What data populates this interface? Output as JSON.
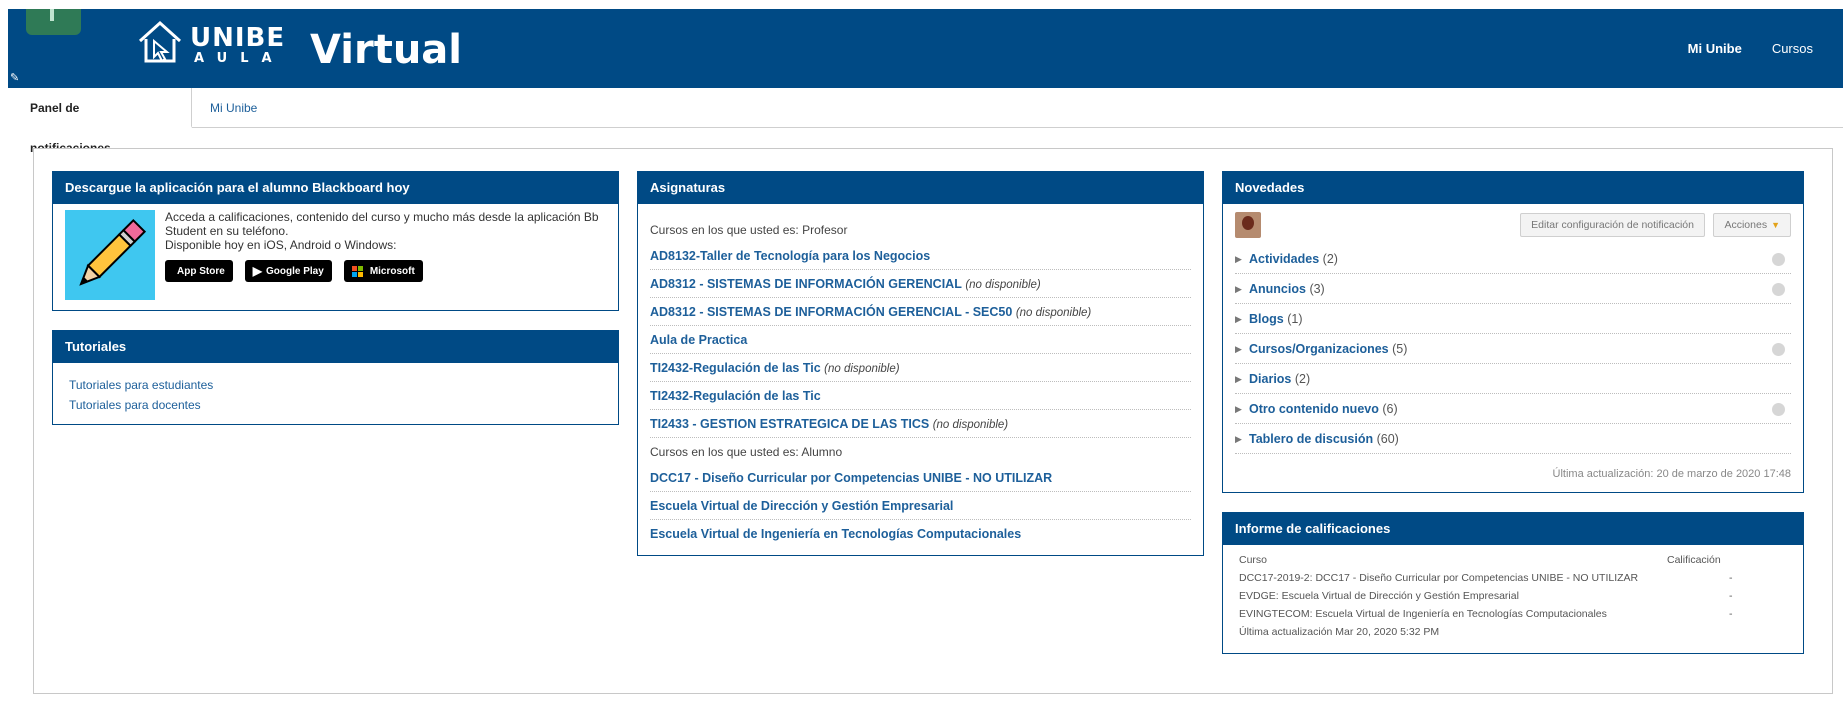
{
  "header": {
    "logo_unibe": "UNIBE",
    "logo_aula": "AULA",
    "logo_virtual": "Virtual",
    "nav": [
      {
        "label": "Mi Unibe"
      },
      {
        "label": "Cursos"
      }
    ],
    "colors": {
      "primary": "#004a85",
      "accent_green": "#2f7a56"
    }
  },
  "tabs": [
    {
      "label": "Panel de notificaciones"
    },
    {
      "label": "Mi Unibe"
    }
  ],
  "download": {
    "title": "Descargue la aplicación para el alumno Blackboard hoy",
    "line1": "Acceda a calificaciones, contenido del curso y mucho más desde la aplicación Bb Student en su teléfono.",
    "line2": "Disponible hoy en iOS, Android o Windows:",
    "stores": [
      "App Store",
      "Google Play",
      "Microsoft"
    ]
  },
  "tutorials": {
    "title": "Tutoriales",
    "links": [
      "Tutoriales para estudiantes",
      "Tutoriales para docentes"
    ]
  },
  "courses": {
    "title": "Asignaturas",
    "teacher_caption": "Cursos en los que usted es: Profesor",
    "teacher_courses": [
      {
        "name": "AD8132-Taller de Tecnología para los Negocios",
        "note": ""
      },
      {
        "name": "AD8312 - SISTEMAS DE INFORMACIÓN GERENCIAL",
        "note": "(no disponible)"
      },
      {
        "name": "AD8312 - SISTEMAS DE INFORMACIÓN GERENCIAL - SEC50",
        "note": "(no disponible)"
      },
      {
        "name": "Aula de Practica",
        "note": ""
      },
      {
        "name": "TI2432-Regulación de las Tic",
        "note": "(no disponible)"
      },
      {
        "name": "TI2432-Regulación de las Tic",
        "note": ""
      },
      {
        "name": "TI2433 - GESTION ESTRATEGICA DE LAS TICS",
        "note": "(no disponible)"
      }
    ],
    "student_caption": "Cursos en los que usted es: Alumno",
    "student_courses": [
      {
        "name": "DCC17 - Diseño Curricular por Competencias UNIBE - NO UTILIZAR"
      },
      {
        "name": "Escuela Virtual de Dirección y Gestión Empresarial"
      },
      {
        "name": "Escuela Virtual de Ingeniería en Tecnologías Computacionales"
      }
    ]
  },
  "news": {
    "title": "Novedades",
    "config_button": "Editar configuración de notificación",
    "actions_button": "Acciones",
    "items": [
      {
        "name": "Actividades",
        "count": "(2)",
        "has_menu": true
      },
      {
        "name": "Anuncios",
        "count": "(3)",
        "has_menu": true
      },
      {
        "name": "Blogs",
        "count": "(1)",
        "has_menu": false
      },
      {
        "name": "Cursos/Organizaciones",
        "count": "(5)",
        "has_menu": true
      },
      {
        "name": "Diarios",
        "count": "(2)",
        "has_menu": false
      },
      {
        "name": "Otro contenido nuevo",
        "count": "(6)",
        "has_menu": true
      },
      {
        "name": "Tablero de discusión",
        "count": "(60)",
        "has_menu": false
      }
    ],
    "last_update": "Última actualización: 20 de marzo de 2020 17:48"
  },
  "grades": {
    "title": "Informe de calificaciones",
    "col_course": "Curso",
    "col_grade": "Calificación",
    "rows": [
      {
        "course": "DCC17-2019-2: DCC17 - Diseño Curricular por Competencias UNIBE - NO UTILIZAR",
        "grade": "-"
      },
      {
        "course": "EVDGE: Escuela Virtual de Dirección y Gestión Empresarial",
        "grade": "-"
      },
      {
        "course": "EVINGTECOM: Escuela Virtual de Ingeniería en Tecnologías Computacionales",
        "grade": "-"
      }
    ],
    "last_update": "Última actualización Mar 20, 2020 5:32 PM"
  }
}
